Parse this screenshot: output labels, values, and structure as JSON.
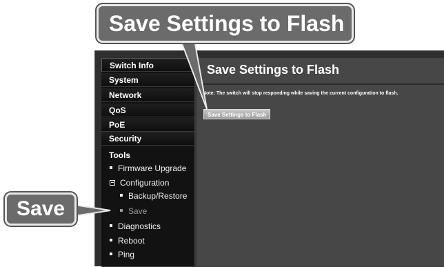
{
  "callouts": {
    "top": "Save Settings to Flash",
    "save": "Save"
  },
  "sidebar": {
    "items": [
      {
        "label": "Switch Info"
      },
      {
        "label": "System"
      },
      {
        "label": "Network"
      },
      {
        "label": "QoS"
      },
      {
        "label": "PoE"
      },
      {
        "label": "Security"
      }
    ],
    "tools": {
      "label": "Tools",
      "children": [
        {
          "label": "Firmware Upgrade"
        },
        {
          "label": "Configuration"
        },
        {
          "label": "Backup/Restore"
        },
        {
          "label": "Save"
        },
        {
          "label": "Diagnostics"
        },
        {
          "label": "Reboot"
        },
        {
          "label": "Ping"
        }
      ]
    }
  },
  "main": {
    "title": "Save Settings to Flash",
    "note": "Note: The switch will stop responding while saving the current configuration to flash.",
    "button": "Save Settings to Flash"
  }
}
